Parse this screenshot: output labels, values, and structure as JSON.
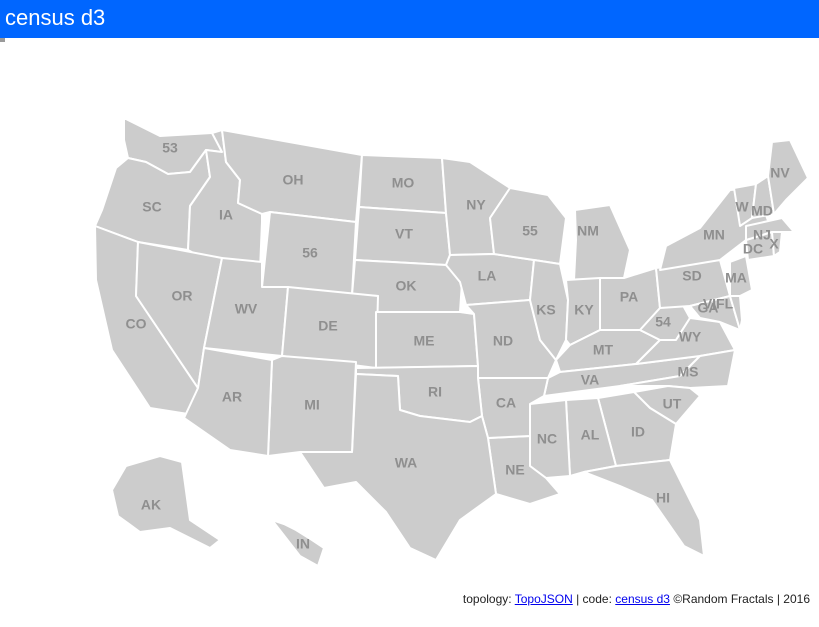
{
  "header": {
    "title": "census d3"
  },
  "colors": {
    "header_bg": "#0066ff",
    "state_fill": "#cccccc",
    "state_border": "#ffffff",
    "label": "#8f8f8f"
  },
  "map": {
    "labels": {
      "WA": "53",
      "OR": "SC",
      "ID": "IA",
      "MT": "OH",
      "ND": "MO",
      "MN": "NY",
      "WI": "55",
      "MI": "NM",
      "ME": "NV",
      "VT": "W",
      "NH": "MD",
      "MA": "DC",
      "NJ": "NJ",
      "RI": "X",
      "CT": "MA",
      "SD": "VT",
      "WY": "56",
      "NE": "OK",
      "CA": "CO",
      "NV": "OR",
      "UT": "WV",
      "CO": "DE",
      "KS": "ME",
      "IA": "LA",
      "IL": "KS",
      "IN": "KY",
      "OH": "PA",
      "NY": "MN",
      "PA": "SD",
      "WV": "54",
      "VA": "WY",
      "KY": "MT",
      "MO": "ND",
      "AZ": "AR",
      "NM": "MI",
      "OK": "RI",
      "AR": "CA",
      "TN": "VA",
      "NC": "MS",
      "SC": "UT",
      "GA": "ID",
      "AL": "AL",
      "MS": "NC",
      "LA": "NE",
      "TX": "WA",
      "FL": "HI",
      "AK": "AK",
      "HI": "IN",
      "MD": "VIFL",
      "DE": "GA"
    }
  },
  "footer": {
    "prefix": "topology:",
    "topo_link": "TopoJSON",
    "sep": "| code:",
    "code_link": "census d3",
    "suffix": "©Random Fractals | 2016"
  }
}
